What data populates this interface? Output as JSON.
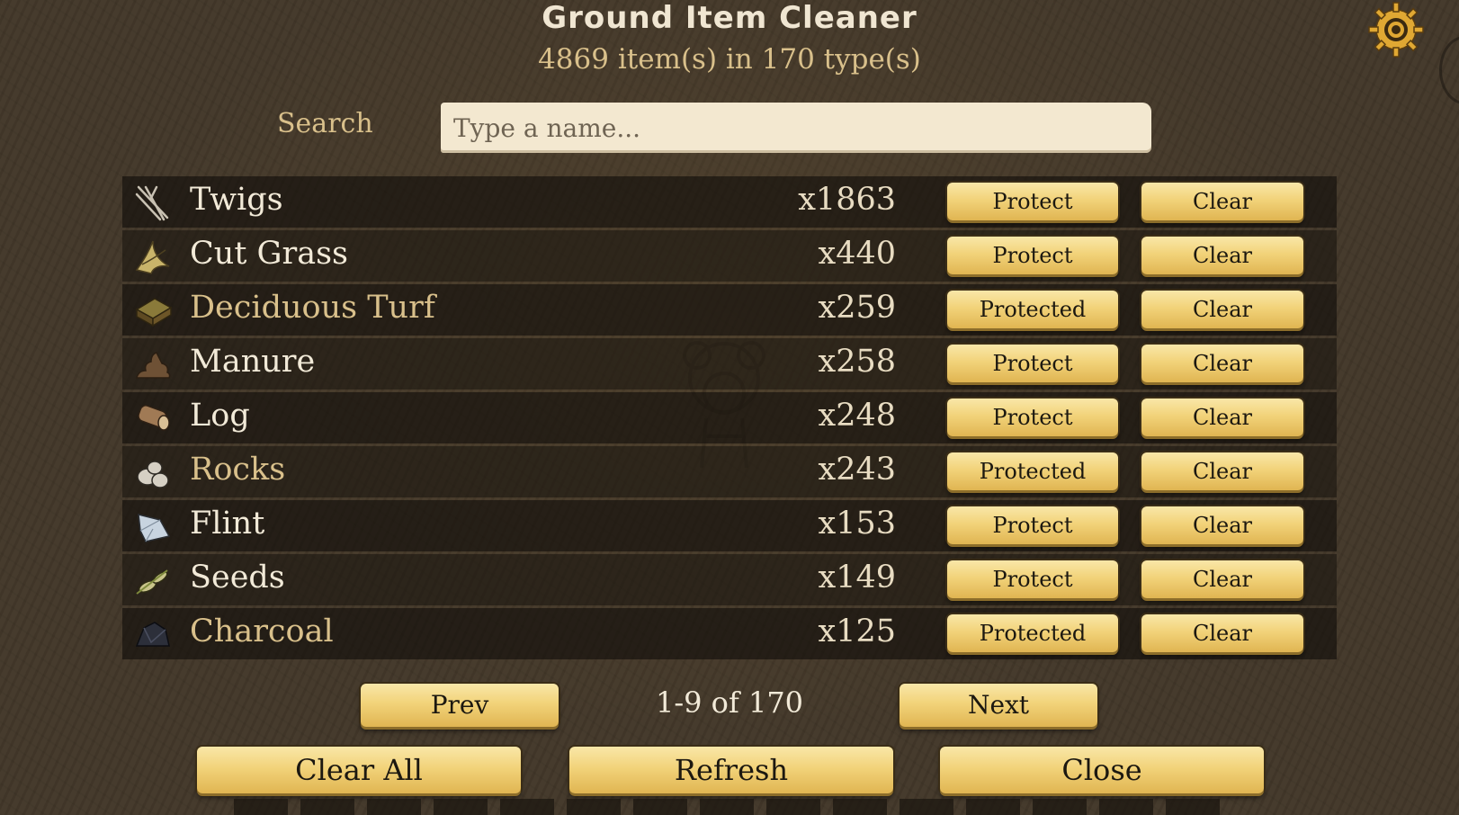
{
  "header": {
    "title": "Ground Item Cleaner",
    "subtitle": "4869 item(s) in 170 type(s)",
    "settings_icon": "gear-icon"
  },
  "search": {
    "label": "Search",
    "placeholder": "Type a name...",
    "value": ""
  },
  "items": [
    {
      "name": "Twigs",
      "count": "x1863",
      "protect_label": "Protect",
      "clear_label": "Clear",
      "protected": false,
      "icon": "twigs-icon"
    },
    {
      "name": "Cut Grass",
      "count": "x440",
      "protect_label": "Protect",
      "clear_label": "Clear",
      "protected": false,
      "icon": "cut-grass-icon"
    },
    {
      "name": "Deciduous Turf",
      "count": "x259",
      "protect_label": "Protected",
      "clear_label": "Clear",
      "protected": true,
      "icon": "deciduous-turf-icon"
    },
    {
      "name": "Manure",
      "count": "x258",
      "protect_label": "Protect",
      "clear_label": "Clear",
      "protected": false,
      "icon": "manure-icon"
    },
    {
      "name": "Log",
      "count": "x248",
      "protect_label": "Protect",
      "clear_label": "Clear",
      "protected": false,
      "icon": "log-icon"
    },
    {
      "name": "Rocks",
      "count": "x243",
      "protect_label": "Protected",
      "clear_label": "Clear",
      "protected": true,
      "icon": "rocks-icon"
    },
    {
      "name": "Flint",
      "count": "x153",
      "protect_label": "Protect",
      "clear_label": "Clear",
      "protected": false,
      "icon": "flint-icon"
    },
    {
      "name": "Seeds",
      "count": "x149",
      "protect_label": "Protect",
      "clear_label": "Clear",
      "protected": false,
      "icon": "seeds-icon"
    },
    {
      "name": "Charcoal",
      "count": "x125",
      "protect_label": "Protected",
      "clear_label": "Clear",
      "protected": true,
      "icon": "charcoal-icon"
    }
  ],
  "pagination": {
    "prev_label": "Prev",
    "info": "1-9 of 170",
    "next_label": "Next"
  },
  "actions": {
    "clear_all_label": "Clear All",
    "refresh_label": "Refresh",
    "close_label": "Close"
  },
  "colors": {
    "background": "#43382a",
    "protected_text": "#d9c08b",
    "button": "#f2d37a"
  }
}
